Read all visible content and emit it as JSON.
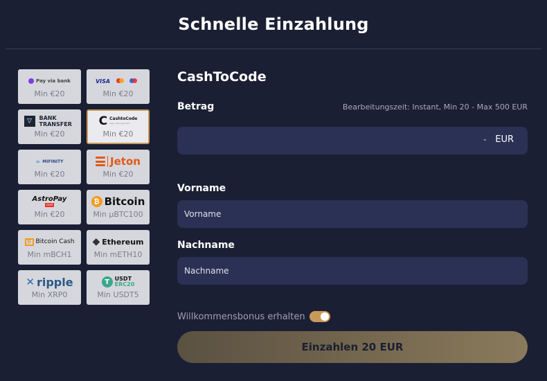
{
  "header": {
    "title": "Schnelle Einzahlung"
  },
  "methods": [
    {
      "id": "payviabank",
      "logo_text": "Pay via bank",
      "min": "Min €20",
      "selected": false
    },
    {
      "id": "cards",
      "logo_text": "VISA",
      "min": "Min €20",
      "selected": false
    },
    {
      "id": "banktransfer",
      "logo_text": "BANK TRANSFER",
      "min": "Min €20",
      "selected": false
    },
    {
      "id": "cashtocode",
      "logo_text": "CashtoCode",
      "logo_sub": "easy cash payment",
      "min": "Min €20",
      "selected": true
    },
    {
      "id": "mifinity",
      "logo_text": "MIFINITY",
      "min": "Min €20",
      "selected": false
    },
    {
      "id": "jeton",
      "logo_text": "Jeton",
      "min": "Min €20",
      "selected": false
    },
    {
      "id": "astropay",
      "logo_text": "AstroPay",
      "logo_sub": "card",
      "min": "Min €20",
      "selected": false
    },
    {
      "id": "bitcoin",
      "logo_text": "Bitcoin",
      "min": "Min µBTC100",
      "selected": false
    },
    {
      "id": "bitcoincash",
      "logo_text": "Bitcoin Cash",
      "min": "Min mBCH1",
      "selected": false
    },
    {
      "id": "ethereum",
      "logo_text": "Ethereum",
      "min": "Min mETH10",
      "selected": false
    },
    {
      "id": "ripple",
      "logo_text": "ripple",
      "min": "Min XRP0",
      "selected": false
    },
    {
      "id": "usdt",
      "logo_text": "USDT",
      "logo_sub": "ERC20",
      "min": "Min USDT5",
      "selected": false
    }
  ],
  "form": {
    "method_title": "CashToCode",
    "amount_label": "Betrag",
    "processing_info": "Bearbeitungszeit: Instant, Min 20 - Max 500 EUR",
    "currency": "EUR",
    "firstname_label": "Vorname",
    "firstname_placeholder": "Vorname",
    "lastname_label": "Nachname",
    "lastname_placeholder": "Nachname",
    "bonus_label": "Willkommensbonus erhalten",
    "bonus_enabled": true,
    "submit_label": "Einzahlen 20 EUR"
  },
  "colors": {
    "background": "#1b1f33",
    "input_bg": "#2b3154",
    "accent": "#c89a5a"
  }
}
